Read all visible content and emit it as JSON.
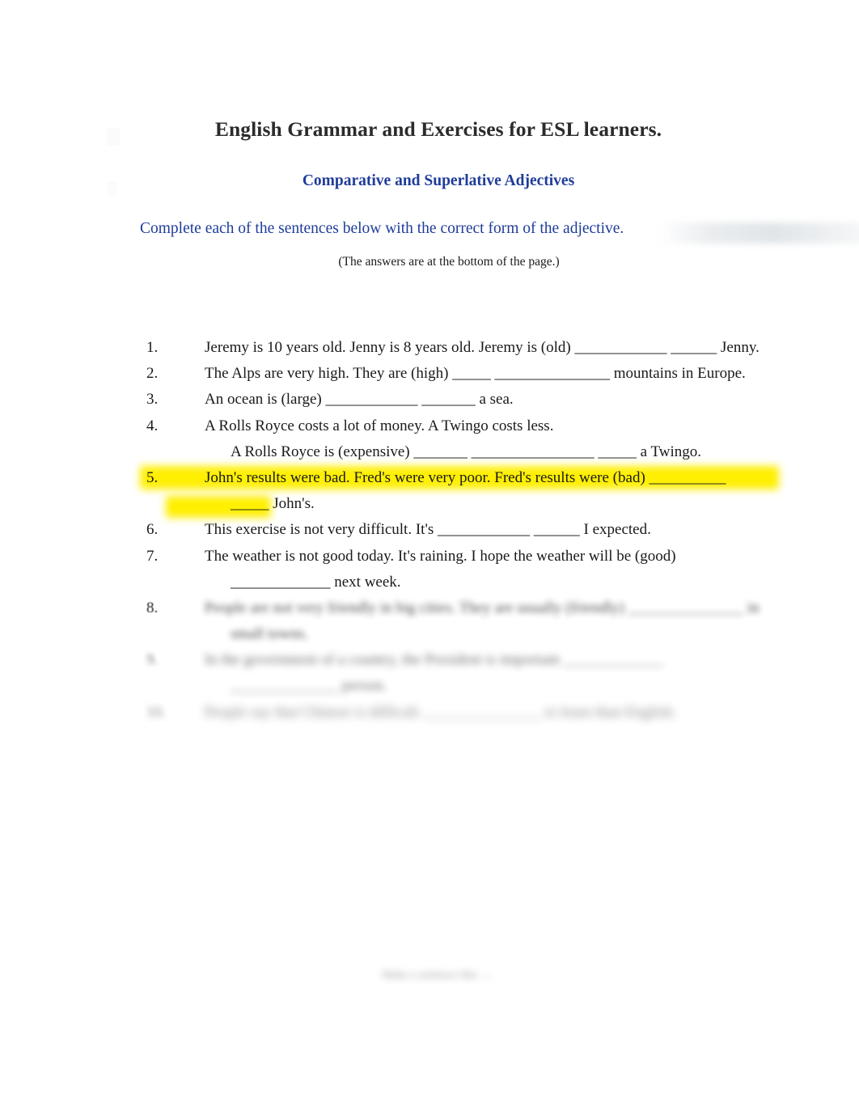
{
  "document": {
    "title": "English Grammar and Exercises for ESL learners.",
    "subtitle": "Comparative and Superlative Adjectives",
    "instruction": "Complete each of the sentences below with the correct form of the adjective.",
    "answers_note": "(The answers are at the bottom of the page.)",
    "footer": "Make a sentence like ...."
  },
  "colors": {
    "heading_blue": "#1f3c99",
    "title_black": "#2b2b2b",
    "highlight_yellow": "#ffef00",
    "page_background": "#ffffff"
  },
  "exercises": [
    {
      "number": "1.",
      "line1": "Jeremy is 10 years old. Jenny is 8 years old. Jeremy is (old) ____________ ______ Jenny.",
      "line2": "",
      "highlighted": false,
      "legible": true
    },
    {
      "number": "2.",
      "line1": "The Alps are very high. They are (high) _____ _______________ mountains in Europe.",
      "line2": "",
      "highlighted": false,
      "legible": true
    },
    {
      "number": "3.",
      "line1": "An ocean is (large) ____________ _______ a sea.",
      "line2": "",
      "highlighted": false,
      "legible": true
    },
    {
      "number": "4.",
      "line1": "A Rolls Royce costs a lot of money. A Twingo costs less.",
      "line2": "A Rolls Royce is (expensive) _______ ________________ _____ a Twingo.",
      "highlighted": false,
      "legible": true
    },
    {
      "number": "5.",
      "line1": "John's results were bad. Fred's were very poor. Fred's results were (bad) __________",
      "line2": "_____ John's.",
      "highlighted": true,
      "legible": true
    },
    {
      "number": "6.",
      "line1": "This exercise is not very difficult. It's ____________ ______ I expected.",
      "line2": "",
      "highlighted": false,
      "legible": true
    },
    {
      "number": "7.",
      "line1": "The weather is not good today. It's raining. I hope the weather will be (good)",
      "line2": "_____________ next week.",
      "highlighted": false,
      "legible": true
    },
    {
      "number": "8.",
      "line1": "People are not very friendly in big cities. They are usually (friendly) _______________ in",
      "line2": "small towns.",
      "highlighted": false,
      "legible": false
    },
    {
      "number": "9.",
      "line1": "In the government of a country, the President is important _____________",
      "line2": "______________ person.",
      "highlighted": false,
      "legible": false
    },
    {
      "number": "10.",
      "line1": "People say that Chinese is difficult. _______________ to learn than English.",
      "line2": "",
      "highlighted": false,
      "legible": false
    }
  ]
}
